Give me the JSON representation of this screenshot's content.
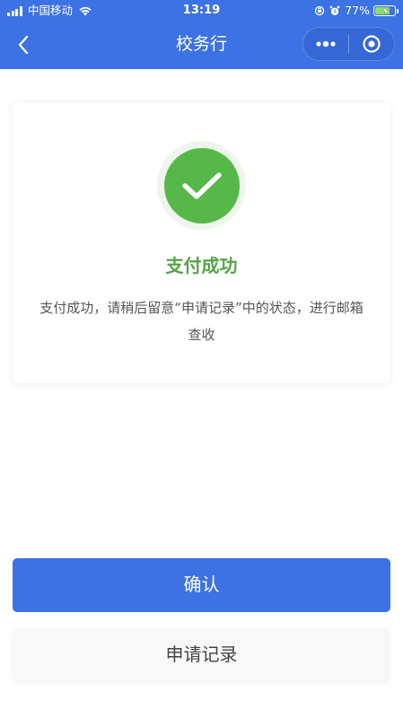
{
  "status_bar": {
    "carrier": "中国移动",
    "time": "13:19",
    "battery_percent": "77%",
    "battery_level": 0.77
  },
  "nav": {
    "title": "校务行",
    "icons": [
      "back-chevron-icon",
      "more-dots-icon",
      "close-target-icon"
    ]
  },
  "result": {
    "icon": "check-icon",
    "title": "支付成功",
    "description": "支付成功，请稍后留意“申请记录”中的状态，进行邮箱查收"
  },
  "actions": {
    "confirm_label": "确认",
    "records_label": "申请记录"
  },
  "colors": {
    "primary": "#3d72e4",
    "success": "#56b849",
    "success_text": "#56a448"
  }
}
